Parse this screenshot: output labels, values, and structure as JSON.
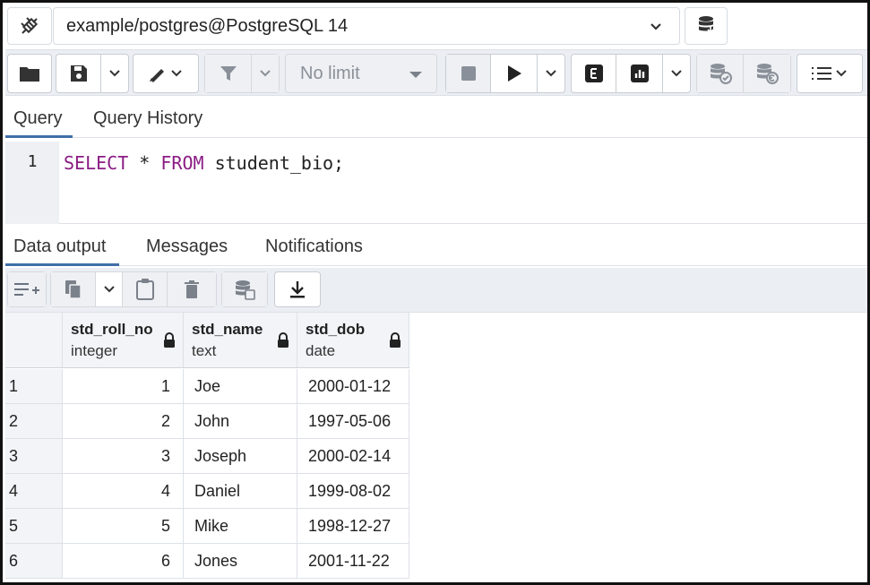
{
  "connection": {
    "label": "example/postgres@PostgreSQL 14",
    "icons": [
      "connection-plug-icon",
      "chevron-down-icon",
      "database-stack-icon"
    ]
  },
  "toolbar": {
    "limit_label": "No limit",
    "icons": [
      "folder-icon",
      "save-icon",
      "chevron-down-icon",
      "pen-icon",
      "filter-icon",
      "stop-icon",
      "play-icon",
      "explain-icon",
      "chart-icon",
      "commit-icon",
      "rollback-icon",
      "macros-icon"
    ]
  },
  "editor_tabs": {
    "query": "Query",
    "history": "Query History"
  },
  "editor": {
    "line_number": "1",
    "code_kw1": "SELECT",
    "code_mid": " * ",
    "code_kw2": "FROM",
    "code_rest": " student_bio;"
  },
  "output_tabs": {
    "data": "Data output",
    "messages": "Messages",
    "notifications": "Notifications"
  },
  "data_toolbar": {
    "icons": [
      "add-row-icon",
      "copy-icon",
      "chevron-down-icon",
      "paste-icon",
      "delete-icon",
      "save-data-icon",
      "download-icon"
    ]
  },
  "table": {
    "columns": [
      {
        "name": "std_roll_no",
        "type": "integer"
      },
      {
        "name": "std_name",
        "type": "text"
      },
      {
        "name": "std_dob",
        "type": "date"
      }
    ],
    "rows": [
      {
        "n": "1",
        "roll": "1",
        "name": "Joe",
        "dob": "2000-01-12"
      },
      {
        "n": "2",
        "roll": "2",
        "name": "John",
        "dob": "1997-05-06"
      },
      {
        "n": "3",
        "roll": "3",
        "name": "Joseph",
        "dob": "2000-02-14"
      },
      {
        "n": "4",
        "roll": "4",
        "name": "Daniel",
        "dob": "1999-08-02"
      },
      {
        "n": "5",
        "roll": "5",
        "name": "Mike",
        "dob": "1998-12-27"
      },
      {
        "n": "6",
        "roll": "6",
        "name": "Jones",
        "dob": "2001-11-22"
      }
    ]
  },
  "colors": {
    "keyword": "#8b1c84",
    "active_tab_underline": "#3f6fa6",
    "toolbar_bg": "#ebeef3"
  }
}
